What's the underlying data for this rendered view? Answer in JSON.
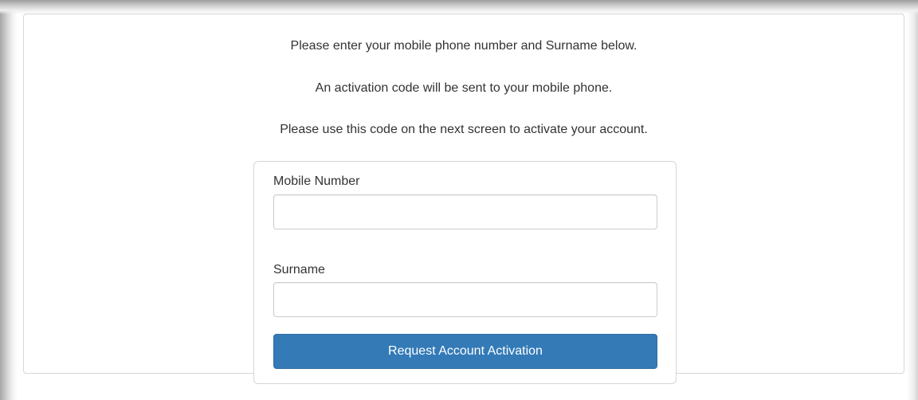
{
  "instructions": {
    "line1": "Please enter your mobile phone number and Surname below.",
    "line2": "An activation code will be sent to your mobile phone.",
    "line3": "Please use this code on the next screen to activate your account."
  },
  "form": {
    "mobile": {
      "label": "Mobile Number",
      "value": "",
      "placeholder": ""
    },
    "surname": {
      "label": "Surname",
      "value": "",
      "placeholder": ""
    },
    "submit_label": "Request Account Activation"
  },
  "colors": {
    "button_background": "#337ab7",
    "button_text": "#ffffff",
    "border": "#d6d6d6",
    "text": "#333333"
  }
}
